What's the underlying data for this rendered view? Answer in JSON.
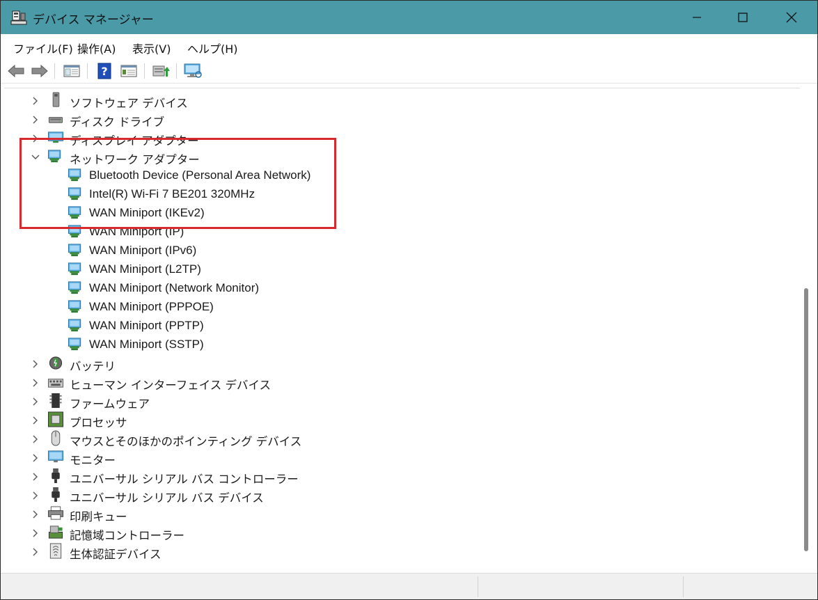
{
  "window": {
    "title": "デバイス マネージャー",
    "titlebar_color": "#4a9aa8",
    "highlight_color": "#d9292e"
  },
  "menu": [
    "ファイル(F)",
    "操作(A)",
    "表示(V)",
    "ヘルプ(H)"
  ],
  "toolbar": [
    {
      "icon": "back-arrow-icon"
    },
    {
      "icon": "forward-arrow-icon"
    },
    {
      "icon": "show-hide-console-tree-icon"
    },
    {
      "icon": "help-icon"
    },
    {
      "icon": "properties-icon"
    },
    {
      "icon": "update-driver-icon"
    },
    {
      "icon": "scan-hardware-changes-icon"
    }
  ],
  "tree": [
    {
      "label": "ソフトウェア デバイス",
      "icon": "software-device-icon",
      "expanded": false
    },
    {
      "label": "ディスク ドライブ",
      "icon": "disk-drive-icon",
      "expanded": false
    },
    {
      "label": "ディスプレイ アダプター",
      "icon": "display-adapter-icon",
      "expanded": false
    },
    {
      "label": "ネットワーク アダプター",
      "icon": "network-adapter-icon",
      "expanded": true,
      "children": [
        "Bluetooth Device (Personal Area Network)",
        "Intel(R) Wi-Fi 7 BE201 320MHz",
        "WAN Miniport (IKEv2)",
        "WAN Miniport (IP)",
        "WAN Miniport (IPv6)",
        "WAN Miniport (L2TP)",
        "WAN Miniport (Network Monitor)",
        "WAN Miniport (PPPOE)",
        "WAN Miniport (PPTP)",
        "WAN Miniport (SSTP)"
      ]
    },
    {
      "label": "バッテリ",
      "icon": "battery-icon",
      "expanded": false
    },
    {
      "label": "ヒューマン インターフェイス デバイス",
      "icon": "hid-icon",
      "expanded": false
    },
    {
      "label": "ファームウェア",
      "icon": "firmware-icon",
      "expanded": false
    },
    {
      "label": "プロセッサ",
      "icon": "processor-icon",
      "expanded": false
    },
    {
      "label": "マウスとそのほかのポインティング デバイス",
      "icon": "mouse-icon",
      "expanded": false
    },
    {
      "label": "モニター",
      "icon": "monitor-icon",
      "expanded": false
    },
    {
      "label": "ユニバーサル シリアル バス コントローラー",
      "icon": "usb-icon",
      "expanded": false
    },
    {
      "label": "ユニバーサル シリアル バス デバイス",
      "icon": "usb-icon",
      "expanded": false
    },
    {
      "label": "印刷キュー",
      "icon": "printer-icon",
      "expanded": false
    },
    {
      "label": "記憶域コントローラー",
      "icon": "storage-controller-icon",
      "expanded": false
    },
    {
      "label": "生体認証デバイス",
      "icon": "biometric-icon",
      "expanded": false
    }
  ]
}
